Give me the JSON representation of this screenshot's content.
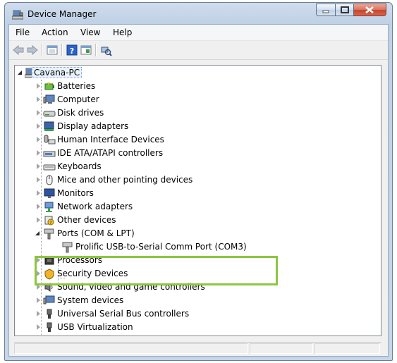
{
  "window": {
    "title": "Device Manager",
    "accent": "#bfd1e6"
  },
  "menu": {
    "items": [
      "File",
      "Action",
      "View",
      "Help"
    ]
  },
  "toolbar": {
    "buttons": [
      "back-icon",
      "forward-icon",
      "properties-icon",
      "help-icon",
      "driver-icon",
      "scan-hardware-icon"
    ]
  },
  "tree": {
    "root": "Cavana-PC",
    "categories": [
      {
        "label": "Batteries",
        "icon": "battery-icon"
      },
      {
        "label": "Computer",
        "icon": "computer-icon"
      },
      {
        "label": "Disk drives",
        "icon": "disk-drive-icon"
      },
      {
        "label": "Display adapters",
        "icon": "display-adapter-icon"
      },
      {
        "label": "Human Interface Devices",
        "icon": "hid-icon"
      },
      {
        "label": "IDE ATA/ATAPI controllers",
        "icon": "ide-controller-icon"
      },
      {
        "label": "Keyboards",
        "icon": "keyboard-icon"
      },
      {
        "label": "Mice and other pointing devices",
        "icon": "mouse-icon"
      },
      {
        "label": "Monitors",
        "icon": "monitor-icon"
      },
      {
        "label": "Network adapters",
        "icon": "network-adapter-icon"
      },
      {
        "label": "Other devices",
        "icon": "other-device-icon"
      },
      {
        "label": "Ports (COM & LPT)",
        "icon": "port-icon",
        "expanded": true,
        "children": [
          {
            "label": "Prolific USB-to-Serial Comm Port (COM3)",
            "icon": "port-icon"
          }
        ]
      },
      {
        "label": "Processors",
        "icon": "processor-icon"
      },
      {
        "label": "Security Devices",
        "icon": "security-device-icon"
      },
      {
        "label": "Sound, video and game controllers",
        "icon": "sound-icon"
      },
      {
        "label": "System devices",
        "icon": "system-device-icon"
      },
      {
        "label": "Universal Serial Bus controllers",
        "icon": "usb-icon"
      },
      {
        "label": "USB Virtualization",
        "icon": "usb-icon"
      }
    ]
  },
  "highlight_color": "#8dc63f"
}
